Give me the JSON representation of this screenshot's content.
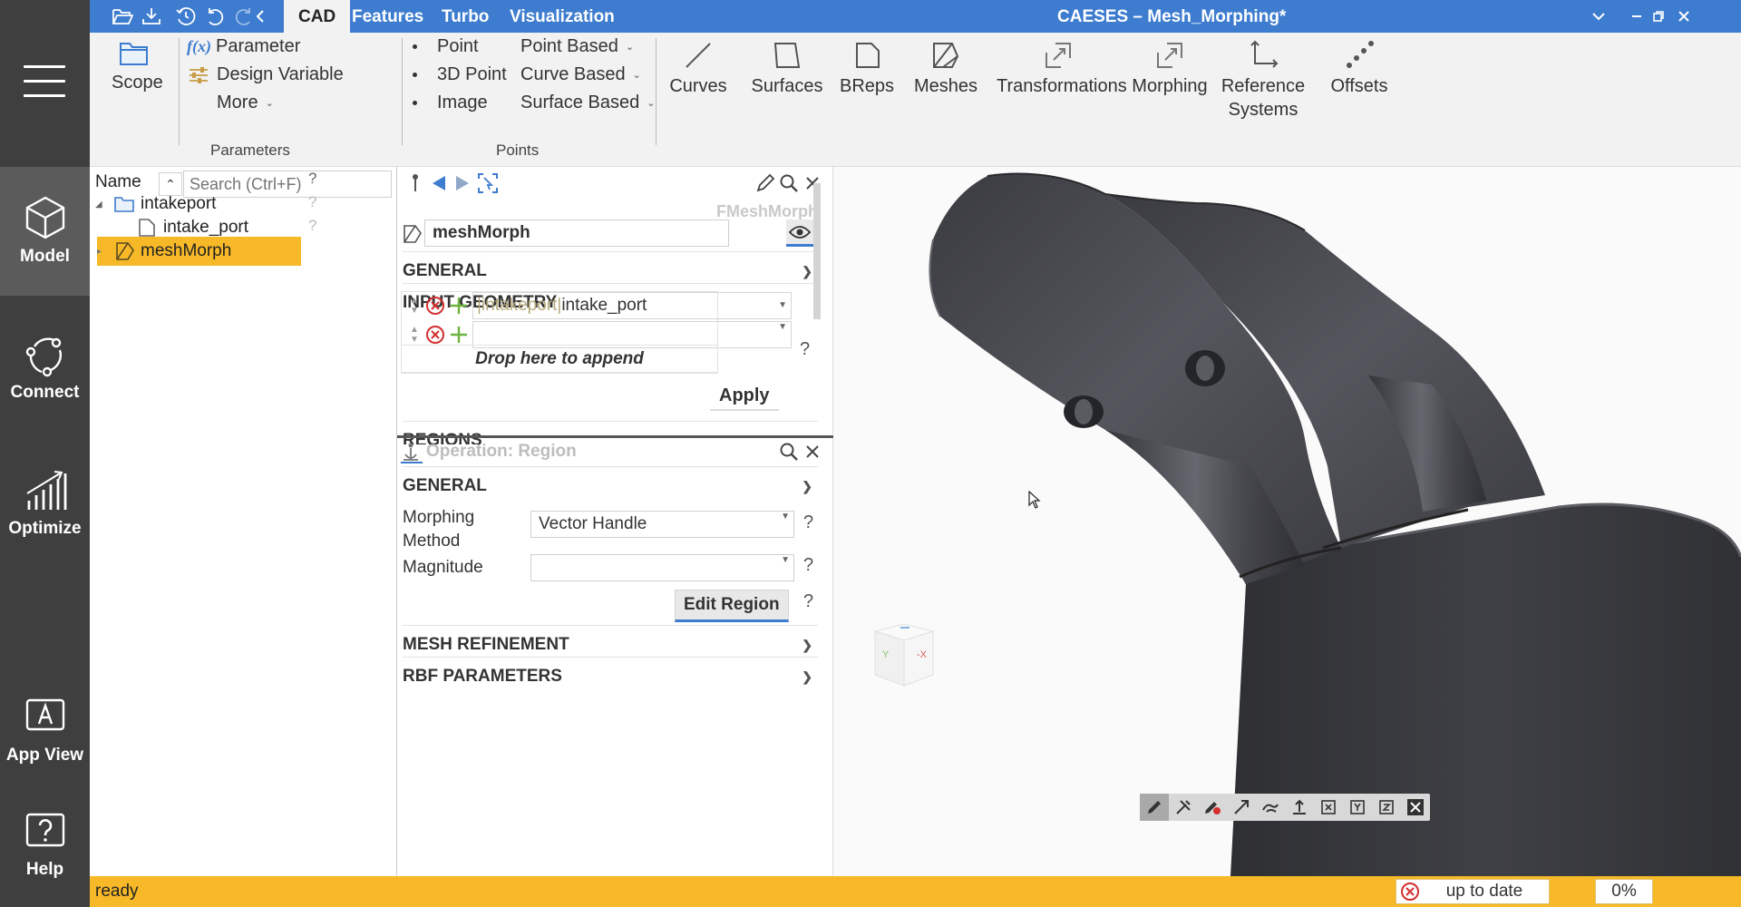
{
  "sidebar": {
    "items": [
      {
        "label": "Model",
        "icon": "cube-icon"
      },
      {
        "label": "Connect",
        "icon": "connect-icon"
      },
      {
        "label": "Optimize",
        "icon": "chart-icon"
      },
      {
        "label": "App View",
        "icon": "app-view-icon"
      },
      {
        "label": "Help",
        "icon": "help-icon"
      }
    ]
  },
  "titlebar": {
    "tabs": [
      "CAD",
      "Features",
      "Turbo",
      "Visualization"
    ],
    "active_tab": "CAD",
    "window_title": "CAESES – Mesh_Morphing*",
    "accent": "#3d7ccf"
  },
  "ribbon": {
    "scope": "Scope",
    "parameter": "Parameter",
    "design_variable": "Design Variable",
    "more": "More",
    "group_parameters": "Parameters",
    "point": "Point",
    "point_3d": "3D Point",
    "image": "Image",
    "point_based": "Point Based",
    "curve_based": "Curve Based",
    "surface_based": "Surface Based",
    "group_points": "Points",
    "curves": "Curves",
    "surfaces": "Surfaces",
    "breps": "BReps",
    "meshes": "Meshes",
    "transformations": "Transformations",
    "morphing": "Morphing",
    "reference_line1": "Reference",
    "reference_line2": "Systems",
    "offsets": "Offsets",
    "fx": "f(x)"
  },
  "tree": {
    "name_header": "Name",
    "search_placeholder": "Search (Ctrl+F)",
    "nodes": [
      {
        "label": "intakeport"
      },
      {
        "label": "intake_port"
      },
      {
        "label": "meshMorph"
      }
    ],
    "q": "?"
  },
  "props": {
    "type_label": "FMeshMorph",
    "object_name": "meshMorph",
    "section_general": "GENERAL",
    "section_input_geometry": "INPUT GEOMETRY",
    "geom_prefix": "|intakeport|",
    "geom_value": "intake_port",
    "drop_text": "Drop here to append",
    "apply": "Apply",
    "section_regions": "REGIONS",
    "op_title": "Operation: Region",
    "op_general": "GENERAL",
    "morph_method_line1": "Morphing",
    "morph_method_line2": "Method",
    "morph_method_value": "Vector Handle",
    "magnitude_label": "Magnitude",
    "magnitude_value": "",
    "edit_region": "Edit Region",
    "section_mesh_refinement": "MESH REFINEMENT",
    "section_rbf": "RBF PARAMETERS",
    "q": "?"
  },
  "viewport": {
    "axis_y": "Y",
    "axis_x": "-X",
    "toolbar_icons": [
      "pencil-icon",
      "tools-icon",
      "pencil-delete-icon",
      "arrow-icon",
      "link-icon",
      "anchor-icon",
      "box-x-icon",
      "box-y-icon",
      "box-z-icon",
      "close-icon"
    ]
  },
  "status": {
    "text": "ready",
    "sync": "up to date",
    "progress": "0%",
    "progress_fraction": 0.0,
    "bar_color": "#f7b928"
  }
}
